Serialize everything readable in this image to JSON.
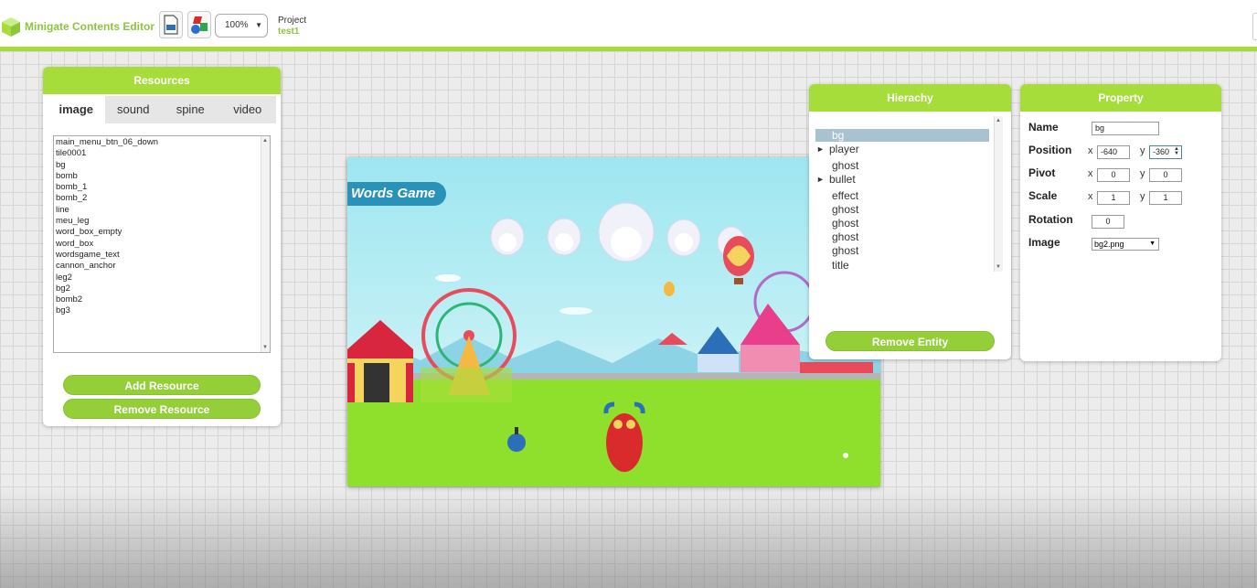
{
  "app": {
    "title": "Minigate Contents Editor"
  },
  "toolbar": {
    "zoom": "100%",
    "project_label": "Project",
    "project_name": "test1"
  },
  "resources": {
    "title": "Resources",
    "tabs": [
      "image",
      "sound",
      "spine",
      "video"
    ],
    "active_tab": "image",
    "items": [
      "main_menu_btn_06_down",
      "tile0001",
      "bg",
      "bomb",
      "bomb_1",
      "bomb_2",
      "line",
      "meu_leg",
      "word_box_empty",
      "word_box",
      "wordsgame_text",
      "cannon_anchor",
      "leg2",
      "bg2",
      "bomb2",
      "bg3"
    ],
    "add_label": "Add Resource",
    "remove_label": "Remove Resource"
  },
  "game": {
    "banner": "Words Game"
  },
  "hierarchy": {
    "title": "Hierachy",
    "items": [
      "bg",
      "player",
      "ghost",
      "bullet",
      "effect",
      "ghost",
      "ghost",
      "ghost",
      "ghost",
      "title"
    ],
    "selected": "bg",
    "remove_label": "Remove Entity"
  },
  "property": {
    "title": "Property",
    "name_label": "Name",
    "name_value": "bg",
    "position_label": "Position",
    "position_x": "-640",
    "position_y": "-360",
    "pivot_label": "Pivot",
    "pivot_x": "0",
    "pivot_y": "0",
    "scale_label": "Scale",
    "scale_x": "1",
    "scale_y": "1",
    "rotation_label": "Rotation",
    "rotation_value": "0",
    "image_label": "Image",
    "image_value": "bg2.png",
    "x_axis": "x",
    "y_axis": "y"
  },
  "colors": {
    "accent": "#a7dd3a",
    "button": "#94cf3a",
    "banner": "#2a92b8"
  }
}
